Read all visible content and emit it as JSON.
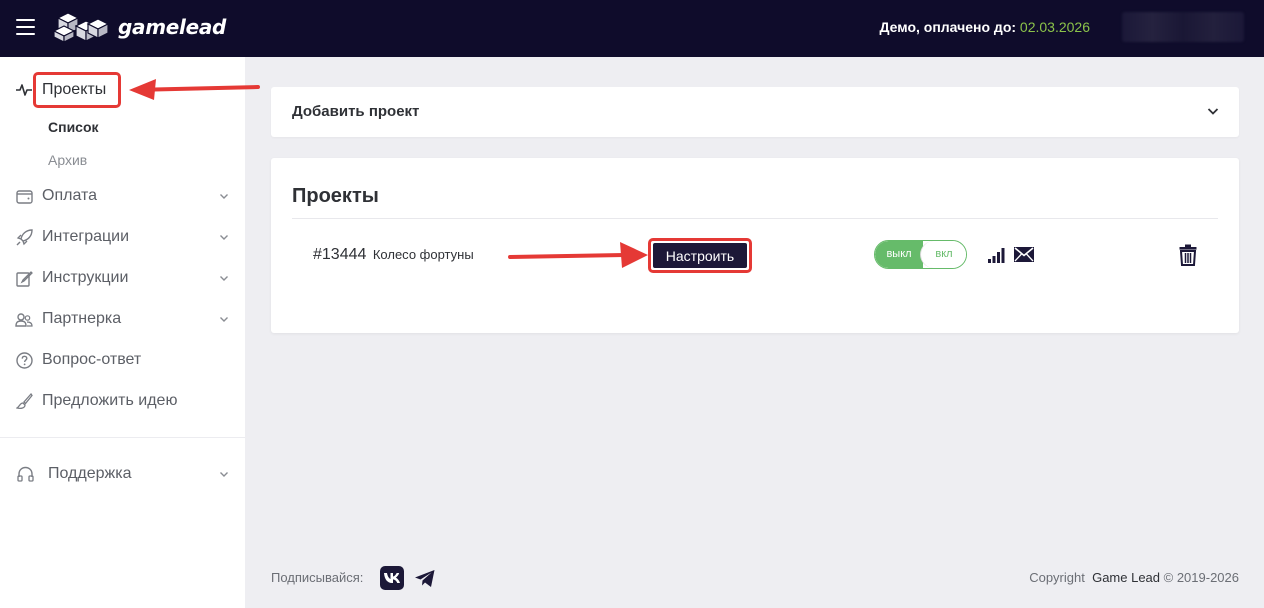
{
  "header": {
    "logo_text": "gamelead",
    "demo_label": "Демо, оплачено до:",
    "demo_date": "02.03.2026"
  },
  "sidebar": {
    "projects": {
      "label": "Проекты",
      "icon": "pulse-icon"
    },
    "sub_items": [
      {
        "label": "Список",
        "active": true
      },
      {
        "label": "Архив",
        "active": false
      }
    ],
    "items": [
      {
        "label": "Оплата",
        "icon": "wallet-icon",
        "has_chevron": true
      },
      {
        "label": "Интеграции",
        "icon": "rocket-icon",
        "has_chevron": true
      },
      {
        "label": "Инструкции",
        "icon": "edit-icon",
        "has_chevron": true
      },
      {
        "label": "Партнерка",
        "icon": "users-icon",
        "has_chevron": true
      },
      {
        "label": "Вопрос-ответ",
        "icon": "question-icon",
        "has_chevron": false
      },
      {
        "label": "Предложить идею",
        "icon": "brush-icon",
        "has_chevron": false
      }
    ],
    "support": {
      "label": "Поддержка",
      "icon": "headphones-icon"
    }
  },
  "main": {
    "add_project": {
      "label": "Добавить проект"
    },
    "projects_card": {
      "title": "Проекты",
      "rows": [
        {
          "id": "#13444",
          "name": "Колесо фортуны",
          "setup_label": "Настроить",
          "toggle_off": "выкл",
          "toggle_on": "вкл"
        }
      ]
    }
  },
  "footer": {
    "subscribe": "Подписывайся:",
    "copyright_prefix": "Copyright",
    "brand": "Game Lead",
    "copyright_suffix": "© 2019-2026"
  },
  "colors": {
    "header_bg": "#0f0c2b",
    "accent_green": "#8bc34a",
    "toggle_green": "#66bb6a",
    "highlight_red": "#e53935",
    "button_dark": "#1c1838"
  }
}
